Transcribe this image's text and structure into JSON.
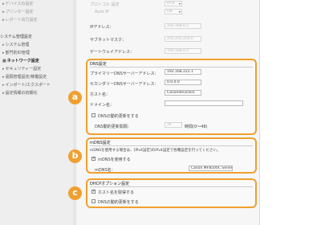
{
  "sidebar": {
    "items_top": [
      {
        "label": "デバイスの設定"
      },
      {
        "label": "プリンター設定"
      },
      {
        "label": "レポート出力設定"
      }
    ],
    "section_heading": "システム管理設定",
    "items": [
      {
        "label": "システム管理"
      },
      {
        "label": "部門別ID管理"
      },
      {
        "label": "ネットワーク設定",
        "active": true
      },
      {
        "label": "セキュリティー設定"
      },
      {
        "label": "遠隔管理設定/稼働設定"
      },
      {
        "label": "インポート/エクスポート"
      },
      {
        "label": "設定情報の初期化"
      }
    ]
  },
  "top_faded": {
    "row1_label": "プロトコル 設定",
    "row1_value": "IPv4",
    "row2_label": "Auto IP",
    "row2_value": "ON"
  },
  "ip_settings": {
    "address_label": "IPアドレス：",
    "address_value": "192.168.0.2",
    "subnet_label": "サブネットマスク：",
    "subnet_value": "255.255.255.0",
    "gateway_label": "ゲートウェイアドレス：",
    "gateway_value": "192.168.0.1"
  },
  "dns": {
    "title": "DNS設定",
    "primary_label": "プライマリーDNSサーバーアドレス：",
    "primary_value": "192.168.222.1",
    "secondary_label": "セカンダリーDNSサーバーアドレス：",
    "secondary_value": "0.0.0.0",
    "host_label": "ホスト名：",
    "host_value": "Canondevice01",
    "domain_label": "ドメイン名：",
    "domain_value": "",
    "dynamic_update_label": "DNSの動的更新をする",
    "dynamic_update_checked": false,
    "interval_label": "DNS動的更新間隔：",
    "interval_value": "24",
    "interval_unit": "時間(0～48)"
  },
  "mdns": {
    "title": "mDNS設定",
    "note": "mDNSを使用する場合は、[IPv4設定]のIPv4設定で各種設定を行ってください。",
    "use_label": "mDNSを使用する",
    "use_checked": true,
    "name_label": "mDNS名：",
    "name_value": "Canon MF8500C Series"
  },
  "dhcp": {
    "title": "DHCPオプション設定",
    "host_label": "ホスト名を取得する",
    "host_checked": true,
    "dns_label": "DNSの動的更新をする",
    "dns_checked": false
  },
  "badges": {
    "a": "a",
    "b": "b",
    "c": "c"
  },
  "colors": {
    "accent": "#f0a030"
  }
}
